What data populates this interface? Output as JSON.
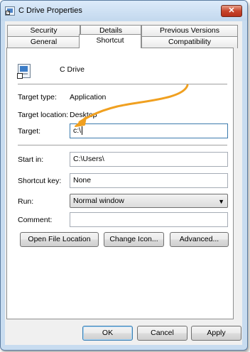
{
  "window": {
    "title": "C Drive Properties",
    "close_glyph": "✕"
  },
  "tabs": {
    "row1": [
      "Security",
      "Details",
      "Previous Versions"
    ],
    "row2": [
      "General",
      "Shortcut",
      "Compatibility"
    ],
    "active": "Shortcut"
  },
  "shortcut": {
    "name": "C Drive",
    "target_type_label": "Target type:",
    "target_type_value": "Application",
    "target_location_label": "Target location:",
    "target_location_value": "Desktop",
    "target_label": "Target:",
    "target_value": "c:\\",
    "start_in_label": "Start in:",
    "start_in_value": "C:\\Users\\",
    "shortcut_key_label": "Shortcut key:",
    "shortcut_key_value": "None",
    "run_label": "Run:",
    "run_value": "Normal window",
    "comment_label": "Comment:",
    "comment_value": ""
  },
  "buttons": {
    "open_file_location": "Open File Location",
    "change_icon": "Change Icon...",
    "advanced": "Advanced...",
    "ok": "OK",
    "cancel": "Cancel",
    "apply": "Apply"
  },
  "icons": {
    "title": "shortcut-icon",
    "shortcut": "shortcut-icon",
    "dropdown": "chevron-down-icon",
    "close": "close-icon"
  },
  "colors": {
    "annotation_arrow": "#f0a020",
    "window_frame": "#c8dcf0",
    "close_button": "#c7462c"
  }
}
